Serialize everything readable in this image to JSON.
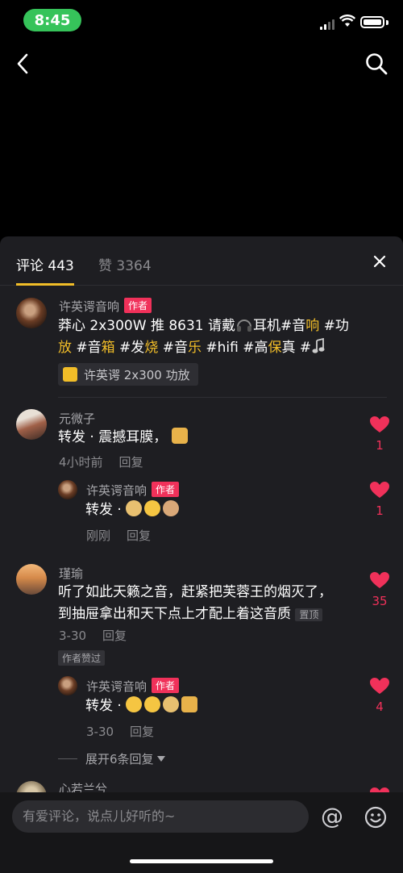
{
  "status_bar": {
    "time": "8:45"
  },
  "tabs": {
    "comments": "评论 443",
    "likes": "赞 3364"
  },
  "post": {
    "author": "许英谔音响",
    "author_tag": "作者",
    "text_parts": [
      "莽心 2x300W 推 8631 请戴",
      "耳机#音",
      "响",
      " #功",
      "放",
      " #音",
      "箱",
      " #发",
      "烧",
      " #音",
      "乐",
      " #hifi #高",
      "保",
      "真",
      " #"
    ],
    "product": "许英谔 2x300 功放"
  },
  "comments": [
    {
      "user": "元微子",
      "text": "转发 · 震撼耳膜，",
      "time": "4小时前",
      "reply": "回复",
      "likes": "1"
    },
    {
      "user": "许英谔音响",
      "tag": "作者",
      "text": "转发 · ",
      "time": "刚刚",
      "reply": "回复",
      "likes": "1"
    },
    {
      "user": "瑾瑜",
      "text_line1": "听了如此天籁之音，赶紧把芙蓉王的烟灭了，",
      "text_line2": "到抽屉拿出和天下点上才配上着这音质",
      "pinned": "置顶",
      "time": "3-30",
      "reply": "回复",
      "author_liked": "作者赞过",
      "likes": "35"
    },
    {
      "user": "许英谔音响",
      "tag": "作者",
      "text": "转发 · ",
      "time": "3-30",
      "reply": "回复",
      "likes": "4"
    }
  ],
  "expand_replies": "展开6条回复",
  "next_user": "心若兰兮",
  "input_placeholder": "有爱评论，说点儿好听的~",
  "at_symbol": "@",
  "colors": {
    "accent": "#f1bd28",
    "like": "#f0315a",
    "sheet": "#1e1e22",
    "status_pill": "#36c35a"
  }
}
